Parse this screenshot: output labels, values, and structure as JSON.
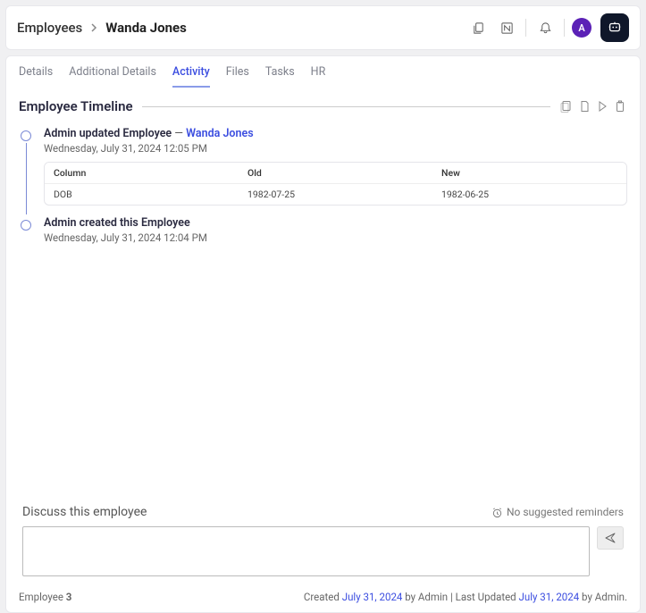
{
  "breadcrumb": {
    "parent": "Employees",
    "current": "Wanda Jones"
  },
  "avatar_initial": "A",
  "tabs": [
    {
      "label": "Details",
      "active": false
    },
    {
      "label": "Additional Details",
      "active": false
    },
    {
      "label": "Activity",
      "active": true
    },
    {
      "label": "Files",
      "active": false
    },
    {
      "label": "Tasks",
      "active": false
    },
    {
      "label": "HR",
      "active": false
    }
  ],
  "section_title": "Employee Timeline",
  "timeline": [
    {
      "title_prefix": "Admin updated Employee",
      "title_dash": " — ",
      "title_link": "Wanda Jones",
      "timestamp": "Wednesday, July 31, 2024 12:05 PM",
      "changes": {
        "headers": {
          "col": "Column",
          "old": "Old",
          "new": "New"
        },
        "row": {
          "col": "DOB",
          "old": "1982-07-25",
          "new": "1982-06-25"
        }
      }
    },
    {
      "title_prefix": "Admin created this Employee",
      "timestamp": "Wednesday, July 31, 2024 12:04 PM"
    }
  ],
  "discuss": {
    "label": "Discuss this employee",
    "reminders": "No suggested reminders"
  },
  "footer": {
    "left_label": "Employee ",
    "left_id": "3",
    "created_label": "Created ",
    "created_date": "July 31, 2024",
    "created_by": " by Admin",
    "separator": " | ",
    "updated_label": "Last Updated ",
    "updated_date": "July 31, 2024",
    "updated_by": " by Admin."
  }
}
